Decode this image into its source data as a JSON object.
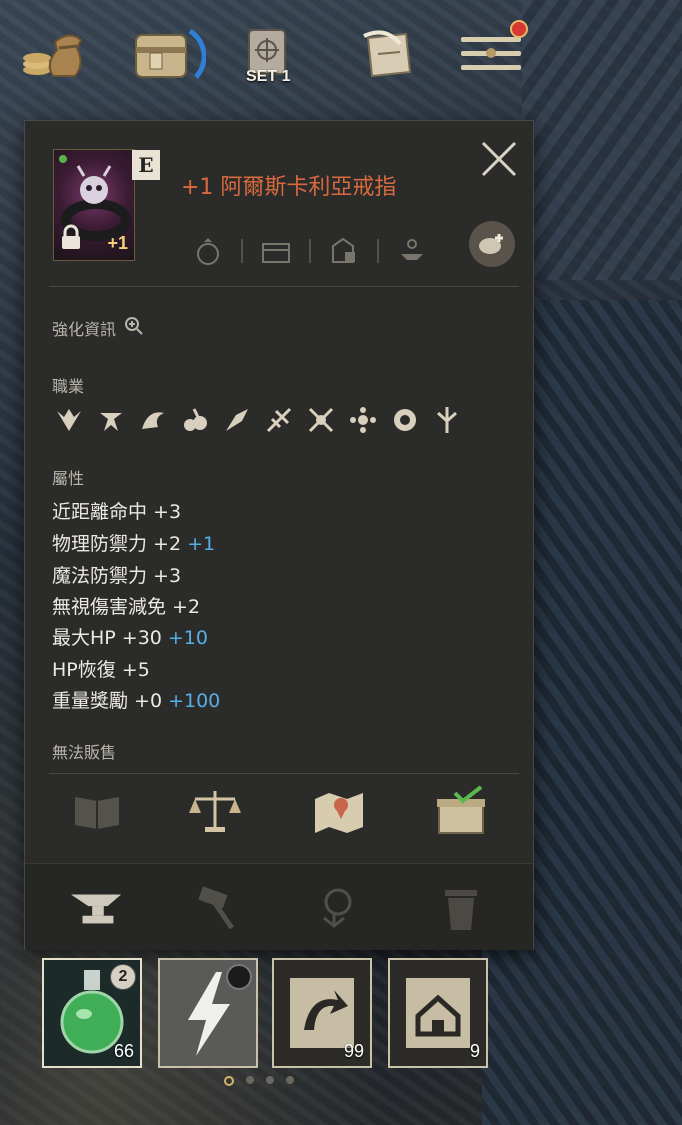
{
  "topbar": {
    "buttons": [
      {
        "icon": "coin-bag-icon"
      },
      {
        "icon": "inventory-icon"
      },
      {
        "icon": "skill-book-icon",
        "label": "SET 1"
      },
      {
        "icon": "quest-scroll-icon"
      },
      {
        "icon": "menu-icon",
        "has_notification": true
      }
    ]
  },
  "item": {
    "title": "+1 阿爾斯卡利亞戒指",
    "grade": "E",
    "enhance": "+1",
    "icon": "skull-ring-icon",
    "locked": true
  },
  "sections": {
    "enhance_info": "強化資訊",
    "job": "職業",
    "attributes": "屬性",
    "unsellable": "無法販售"
  },
  "jobs": [
    "knight-class-icon",
    "warrior-class-icon",
    "wizard-class-icon",
    "elf-class-icon",
    "darkelf-class-icon",
    "gunner-class-icon",
    "axe-class-icon",
    "priest-class-icon",
    "monk-class-icon",
    "spear-class-icon"
  ],
  "stats": [
    {
      "text": "近距離命中 +3",
      "bonus": ""
    },
    {
      "text": "物理防禦力 +2",
      "bonus": "+1"
    },
    {
      "text": "魔法防禦力 +3",
      "bonus": ""
    },
    {
      "text": "無視傷害減免 +2",
      "bonus": ""
    },
    {
      "text": "最大HP +30",
      "bonus": "+10"
    },
    {
      "text": "HP恢復 +5",
      "bonus": ""
    },
    {
      "text": "重量獎勵 +0",
      "bonus": "+100"
    }
  ],
  "quickslots": [
    {
      "icon": "green-potion-icon",
      "count": "66",
      "stack": "2"
    },
    {
      "icon": "lightning-skill-icon",
      "count": "",
      "stack": ""
    },
    {
      "icon": "return-scroll-icon",
      "count": "99",
      "stack": ""
    },
    {
      "icon": "home-scroll-icon",
      "count": "9",
      "stack": ""
    }
  ],
  "colors": {
    "title": "#d86a3e",
    "bonus": "#55aee6",
    "panel": "#2b2b29"
  }
}
